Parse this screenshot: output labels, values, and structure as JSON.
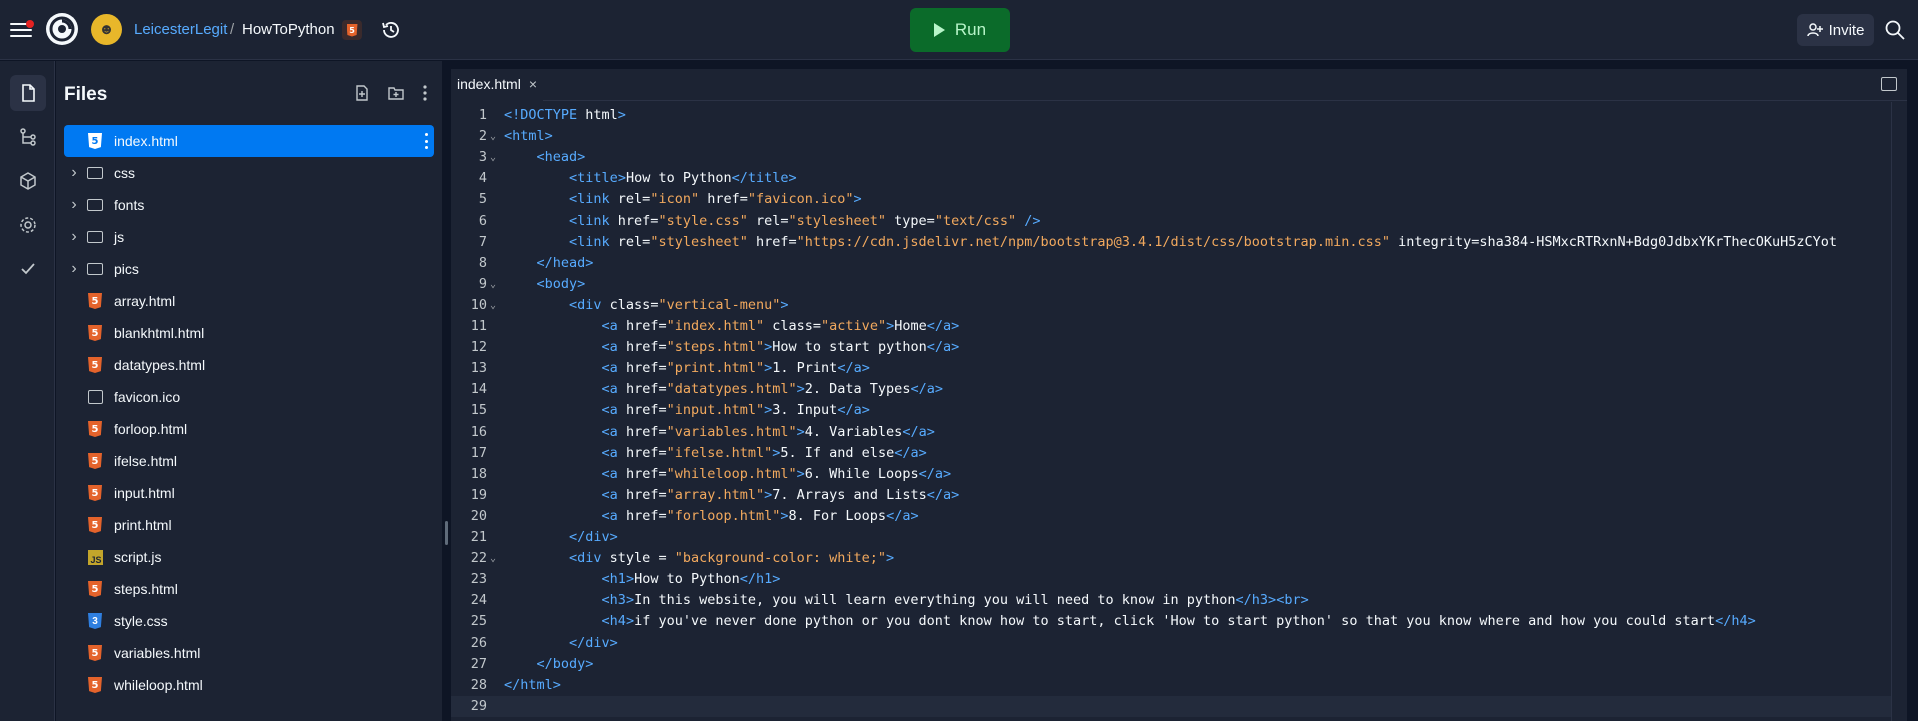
{
  "topbar": {
    "breadcrumb_user": "LeicesterLegit",
    "breadcrumb_sep": "/",
    "breadcrumb_repl": "HowToPython",
    "run_label": "Run",
    "invite_label": "Invite"
  },
  "files": {
    "title": "Files",
    "items": [
      {
        "name": "index.html",
        "kind": "html",
        "selected": true
      },
      {
        "name": "css",
        "kind": "folder"
      },
      {
        "name": "fonts",
        "kind": "folder"
      },
      {
        "name": "js",
        "kind": "folder"
      },
      {
        "name": "pics",
        "kind": "folder"
      },
      {
        "name": "array.html",
        "kind": "html"
      },
      {
        "name": "blankhtml.html",
        "kind": "html"
      },
      {
        "name": "datatypes.html",
        "kind": "html"
      },
      {
        "name": "favicon.ico",
        "kind": "image"
      },
      {
        "name": "forloop.html",
        "kind": "html"
      },
      {
        "name": "ifelse.html",
        "kind": "html"
      },
      {
        "name": "input.html",
        "kind": "html"
      },
      {
        "name": "print.html",
        "kind": "html"
      },
      {
        "name": "script.js",
        "kind": "js"
      },
      {
        "name": "steps.html",
        "kind": "html"
      },
      {
        "name": "style.css",
        "kind": "css"
      },
      {
        "name": "variables.html",
        "kind": "html"
      },
      {
        "name": "whileloop.html",
        "kind": "html"
      }
    ]
  },
  "editor": {
    "tab_label": "index.html",
    "tab_close": "×",
    "lines": [
      {
        "n": "1",
        "fold": "",
        "code": "<!DOCTYPE html>"
      },
      {
        "n": "2",
        "fold": "⌄",
        "code": "<html>"
      },
      {
        "n": "3",
        "fold": "⌄",
        "code": "    <head>"
      },
      {
        "n": "4",
        "fold": "",
        "code": "        <title>How to Python</title>"
      },
      {
        "n": "5",
        "fold": "",
        "code": "        <link rel=\"icon\" href=\"favicon.ico\">"
      },
      {
        "n": "6",
        "fold": "",
        "code": "        <link href=\"style.css\" rel=\"stylesheet\" type=\"text/css\" />"
      },
      {
        "n": "7",
        "fold": "",
        "code": "        <link rel=\"stylesheet\" href=\"https://cdn.jsdelivr.net/npm/bootstrap@3.4.1/dist/css/bootstrap.min.css\" integrity=\"sha384-HSMxcRTRxnN+Bdg0JdbxYKrThecOKuH5zCYot"
      },
      {
        "n": "8",
        "fold": "",
        "code": "    </head>"
      },
      {
        "n": "9",
        "fold": "⌄",
        "code": "    <body>"
      },
      {
        "n": "10",
        "fold": "⌄",
        "code": "        <div class=\"vertical-menu\">"
      },
      {
        "n": "11",
        "fold": "",
        "code": "            <a href=\"index.html\" class=\"active\">Home</a>"
      },
      {
        "n": "12",
        "fold": "",
        "code": "            <a href=\"steps.html\">How to start python</a>"
      },
      {
        "n": "13",
        "fold": "",
        "code": "            <a href=\"print.html\">1. Print</a>"
      },
      {
        "n": "14",
        "fold": "",
        "code": "            <a href=\"datatypes.html\">2. Data Types</a>"
      },
      {
        "n": "15",
        "fold": "",
        "code": "            <a href=\"input.html\">3. Input</a>"
      },
      {
        "n": "16",
        "fold": "",
        "code": "            <a href=\"variables.html\">4. Variables</a>"
      },
      {
        "n": "17",
        "fold": "",
        "code": "            <a href=\"ifelse.html\">5. If and else</a>"
      },
      {
        "n": "18",
        "fold": "",
        "code": "            <a href=\"whileloop.html\">6. While Loops</a>"
      },
      {
        "n": "19",
        "fold": "",
        "code": "            <a href=\"array.html\">7. Arrays and Lists</a>"
      },
      {
        "n": "20",
        "fold": "",
        "code": "            <a href=\"forloop.html\">8. For Loops</a>"
      },
      {
        "n": "21",
        "fold": "",
        "code": "        </div>"
      },
      {
        "n": "22",
        "fold": "⌄",
        "code": "        <div style = \"background-color: white;\">"
      },
      {
        "n": "23",
        "fold": "",
        "code": "            <h1>How to Python</h1>"
      },
      {
        "n": "24",
        "fold": "",
        "code": "            <h3>In this website, you will learn everything you will need to know in python</h3><br>"
      },
      {
        "n": "25",
        "fold": "",
        "code": "            <h4>if you've never done python or you dont know how to start, click 'How to start python' so that you know where and how you could start</h4>"
      },
      {
        "n": "26",
        "fold": "",
        "code": "        </div>"
      },
      {
        "n": "27",
        "fold": "",
        "code": "    </body>"
      },
      {
        "n": "28",
        "fold": "",
        "code": "</html>"
      },
      {
        "n": "29",
        "fold": "",
        "code": ""
      }
    ]
  },
  "colors": {
    "accent": "#0079f2",
    "run_bg": "#0b6b2a",
    "tag": "#57abff",
    "string": "#f2a95e"
  }
}
